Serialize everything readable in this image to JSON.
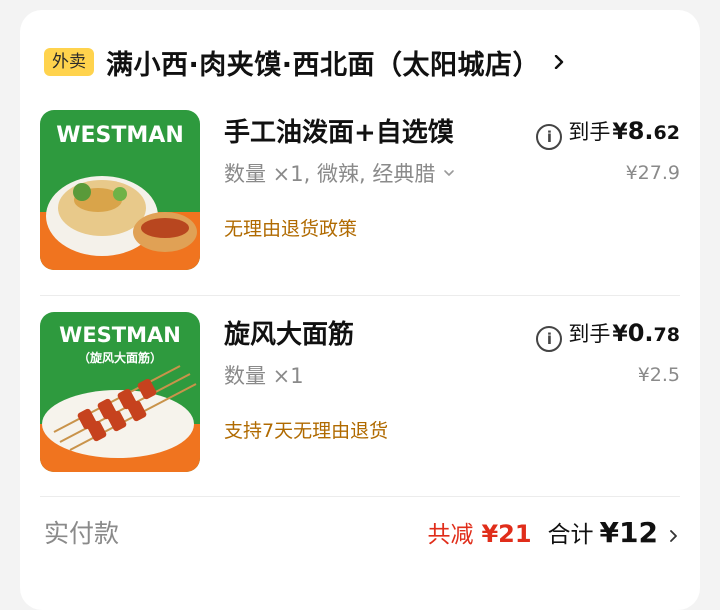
{
  "store": {
    "badge": "外卖",
    "name": "满小西·肉夹馍·西北面（太阳城店）"
  },
  "items": [
    {
      "title": "手工油泼面+自选馍",
      "meta": "数量 ×1, 微辣, 经典腊",
      "policy": "无理由退货政策",
      "pay_label": "到手",
      "currency": "¥",
      "pay_int": "8.",
      "pay_dec": "62",
      "original_price": "¥27.9",
      "thumb_brand": "WESTMAN",
      "thumb_sub": ""
    },
    {
      "title": "旋风大面筋",
      "meta": "数量 ×1",
      "policy": "支持7天无理由退货",
      "pay_label": "到手",
      "currency": "¥",
      "pay_int": "0.",
      "pay_dec": "78",
      "original_price": "¥2.5",
      "thumb_brand": "WESTMAN",
      "thumb_sub": "（旋风大面筋）"
    }
  ],
  "footer": {
    "label": "实付款",
    "discount_label": "共减",
    "discount_amount": "¥21",
    "total_label": "合计",
    "total_amount": "¥12"
  },
  "colors": {
    "badge_bg": "#ffd34d",
    "thumb_green": "#2e9a3e",
    "thumb_orange": "#f0741f",
    "policy_text": "#b06a00",
    "discount_red": "#e02d1a"
  },
  "icons": [
    "chevron-right-icon",
    "chevron-down-icon",
    "info-icon"
  ]
}
